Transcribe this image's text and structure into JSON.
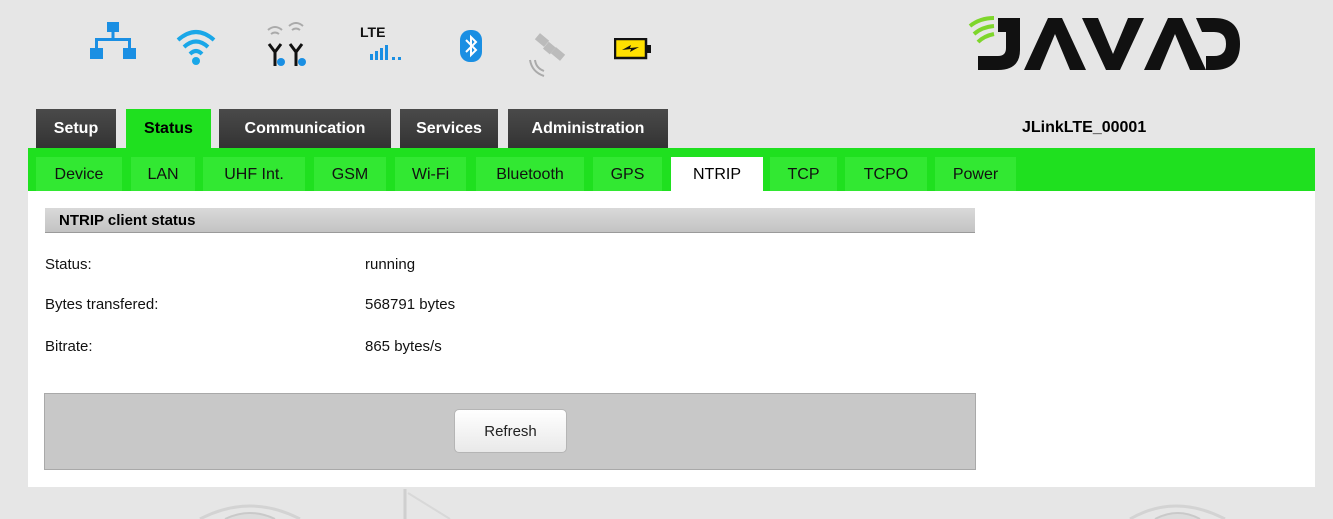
{
  "status_icons": {
    "network": "network-icon",
    "wifi": "wifi-icon",
    "uhf": "uhf-antenna-icon",
    "lte_label": "LTE",
    "bluetooth": "bluetooth-icon",
    "satellite": "satellite-icon",
    "battery": "battery-icon"
  },
  "logo_text": "JAVAD",
  "device_name": "JLinkLTE_00001",
  "main_tabs": [
    {
      "label": "Setup"
    },
    {
      "label": "Status",
      "active": true
    },
    {
      "label": "Communication"
    },
    {
      "label": "Services"
    },
    {
      "label": "Administration"
    }
  ],
  "sub_tabs": [
    {
      "label": "Device"
    },
    {
      "label": "LAN"
    },
    {
      "label": "UHF Int."
    },
    {
      "label": "GSM"
    },
    {
      "label": "Wi-Fi"
    },
    {
      "label": "Bluetooth"
    },
    {
      "label": "GPS"
    },
    {
      "label": "NTRIP",
      "active": true
    },
    {
      "label": "TCP"
    },
    {
      "label": "TCPO"
    },
    {
      "label": "Power"
    }
  ],
  "section": {
    "title": "NTRIP client status",
    "rows": [
      {
        "label": "Status:",
        "value": "running"
      },
      {
        "label": "Bytes transfered:",
        "value": "568791 bytes"
      },
      {
        "label": "Bitrate:",
        "value": "865 bytes/s"
      }
    ]
  },
  "refresh_label": "Refresh",
  "colors": {
    "accent_green": "#1fe01f",
    "tab_dark": "#3a3a3a",
    "icon_blue": "#1a8fe3"
  }
}
